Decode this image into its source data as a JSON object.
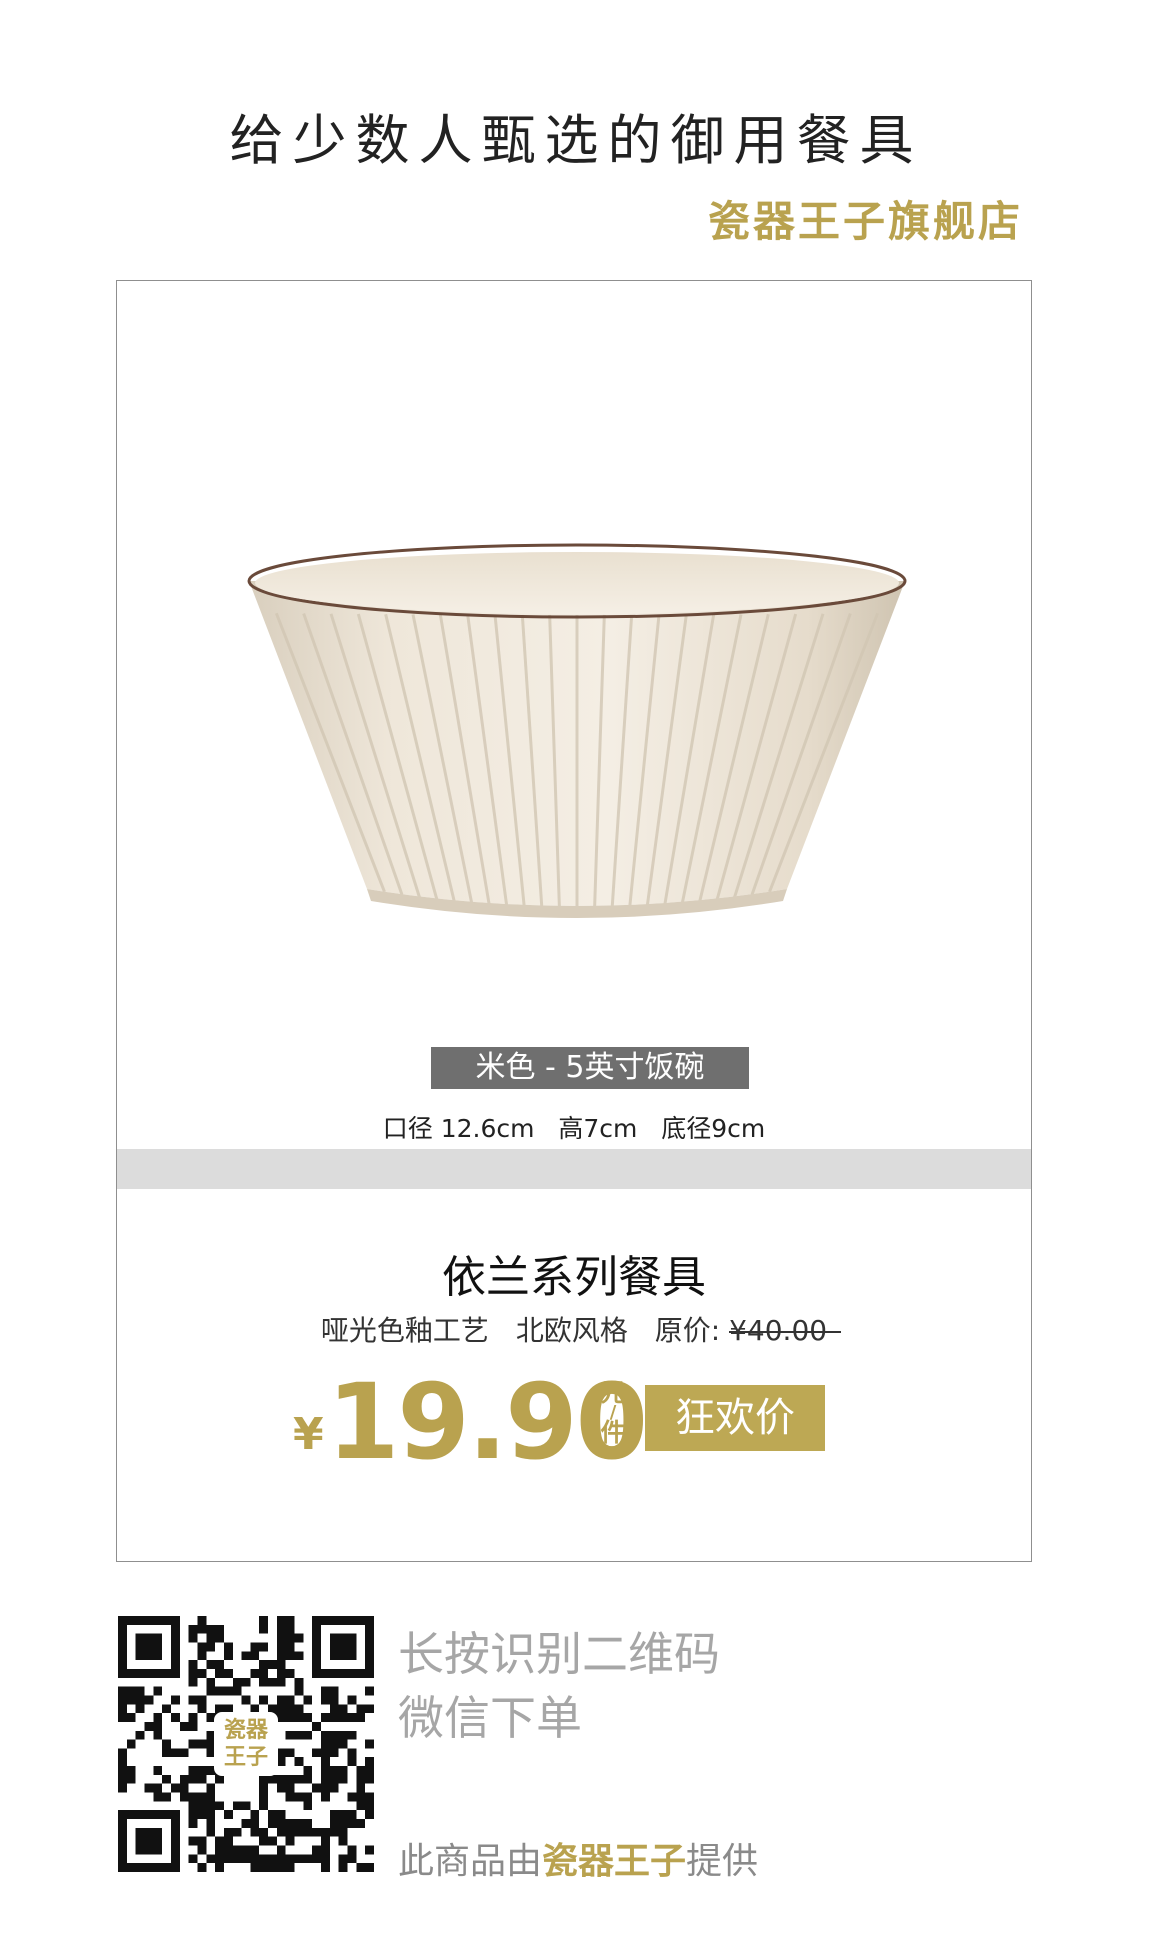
{
  "header": {
    "slogan": "给少数人甄选的御用餐具",
    "brand": "瓷器王子旗舰店"
  },
  "product": {
    "variant": "米色 - 5英寸饭碗",
    "dimensions": "口径 12.6cm   高7cm   底径9cm",
    "series_title": "依兰系列餐具",
    "craft": "哑光色釉工艺",
    "style": "北欧风格",
    "original_price_label": "原价:",
    "original_price": "¥40.00",
    "currency": "¥",
    "sale_price": "19.90",
    "unit_line1": "元",
    "unit_slash": "/",
    "unit_line2": "件",
    "sale_badge": "狂欢价",
    "bowl_color": "#ede4d6",
    "rim_color": "#6a4a3a"
  },
  "footer": {
    "qr_line1": "长按识别二维码",
    "qr_line2": "微信下单",
    "qr_logo_line1": "瓷器",
    "qr_logo_line2": "王子",
    "provider_prefix": "此商品由",
    "provider_shop": "瓷器王子",
    "provider_suffix": "提供"
  },
  "colors": {
    "gold": "#b9a24f",
    "badge": "#bda854",
    "variant_bg": "#6f6f6f",
    "band": "#dcdcdc"
  }
}
